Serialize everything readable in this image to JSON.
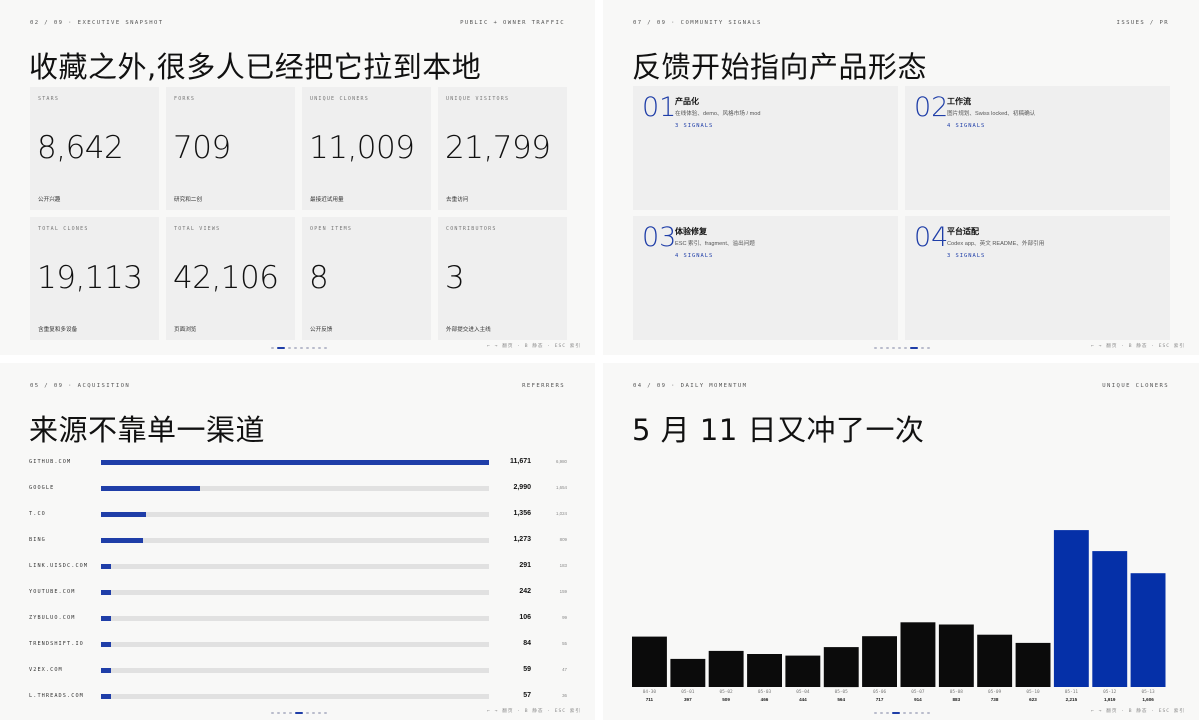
{
  "slides": [
    {
      "kicker": "02 / 09 · EXECUTIVE SNAPSHOT",
      "tag": "PUBLIC + OWNER TRAFFIC",
      "headline": "收藏之外,很多人已经把它拉到本地",
      "metrics": [
        {
          "label": "STARS",
          "value": "8,642",
          "note": "公开兴趣"
        },
        {
          "label": "FORKS",
          "value": "709",
          "note": "研究和二创"
        },
        {
          "label": "UNIQUE CLONERS",
          "value": "11,009",
          "note": "最接近试用量"
        },
        {
          "label": "UNIQUE VISITORS",
          "value": "21,799",
          "note": "去重访问"
        },
        {
          "label": "TOTAL CLONES",
          "value": "19,113",
          "note": "含重复和多设备"
        },
        {
          "label": "TOTAL VIEWS",
          "value": "42,106",
          "note": "页面浏览"
        },
        {
          "label": "OPEN ITEMS",
          "value": "8",
          "note": "公开反馈"
        },
        {
          "label": "CONTRIBUTORS",
          "value": "3",
          "note": "外部提交进入主线"
        }
      ],
      "nav_hint": "← → 翻页 · B 静态 · ESC 索引",
      "page_active": 1,
      "page_count": 9
    },
    {
      "kicker": "07 / 09 · COMMUNITY SIGNALS",
      "tag": "ISSUES / PR",
      "headline": "反馈开始指向产品形态",
      "signals": [
        {
          "num": "01",
          "title": "产品化",
          "desc": "在线体验、demo、风格市场 / mod",
          "count": "3 SIGNALS"
        },
        {
          "num": "02",
          "title": "工作流",
          "desc": "图片规划、Swiss locked、初稿确认",
          "count": "4 SIGNALS"
        },
        {
          "num": "03",
          "title": "体验修复",
          "desc": "ESC 索引、fragment、溢出问题",
          "count": "4 SIGNALS"
        },
        {
          "num": "04",
          "title": "平台适配",
          "desc": "Codex app、英文 README、外部引用",
          "count": "3 SIGNALS"
        }
      ],
      "nav_hint": "← → 翻页 · B 静态 · ESC 索引",
      "page_active": 6,
      "page_count": 9
    },
    {
      "kicker": "05 / 09 · ACQUISITION",
      "tag": "REFERRERS",
      "headline": "来源不靠单一渠道",
      "referrers": [
        {
          "name": "GITHUB.COM",
          "views": 11671,
          "views_label": "11,671",
          "uniques": "6,980"
        },
        {
          "name": "GOOGLE",
          "views": 2990,
          "views_label": "2,990",
          "uniques": "1,654"
        },
        {
          "name": "T.CO",
          "views": 1356,
          "views_label": "1,356",
          "uniques": "1,024"
        },
        {
          "name": "BING",
          "views": 1273,
          "views_label": "1,273",
          "uniques": "809"
        },
        {
          "name": "LINK.UISDC.COM",
          "views": 291,
          "views_label": "291",
          "uniques": "183"
        },
        {
          "name": "YOUTUBE.COM",
          "views": 242,
          "views_label": "242",
          "uniques": "159"
        },
        {
          "name": "ZYBULUO.COM",
          "views": 106,
          "views_label": "106",
          "uniques": "99"
        },
        {
          "name": "TRENDSHIFT.IO",
          "views": 84,
          "views_label": "84",
          "uniques": "55"
        },
        {
          "name": "V2EX.COM",
          "views": 59,
          "views_label": "59",
          "uniques": "47"
        },
        {
          "name": "L.THREADS.COM",
          "views": 57,
          "views_label": "57",
          "uniques": "36"
        }
      ],
      "nav_hint": "← → 翻页 · B 静态 · ESC 索引",
      "page_active": 4,
      "page_count": 9
    },
    {
      "kicker": "04 / 09 · DAILY MOMENTUM",
      "tag": "UNIQUE CLONERS",
      "headline": "5 月 11 日又冲了一次",
      "nav_hint": "← → 翻页 · B 静态 · ESC 索引",
      "page_active": 3,
      "page_count": 9
    }
  ],
  "chart_data": {
    "type": "bar",
    "categories": [
      "04-30",
      "05-01",
      "05-02",
      "05-03",
      "05-04",
      "05-05",
      "05-06",
      "05-07",
      "05-08",
      "05-09",
      "05-10",
      "05-11",
      "05-12",
      "05-13"
    ],
    "values": [
      711,
      397,
      509,
      466,
      444,
      564,
      717,
      914,
      883,
      738,
      623,
      2215,
      1919,
      1606
    ],
    "value_labels": [
      "711",
      "397",
      "509",
      "466",
      "444",
      "564",
      "717",
      "914",
      "883",
      "738",
      "623",
      "2,215",
      "1,919",
      "1,606"
    ],
    "highlight_from_index": 11,
    "colors": {
      "default": "#0b0b0b",
      "highlight": "#0530a8"
    },
    "title": "",
    "xlabel": "",
    "ylabel": "",
    "ylim": [
      0,
      2400
    ]
  },
  "colors": {
    "accent": "#1f3ea8",
    "card": "#efefef",
    "slide": "#f8f8f7",
    "bar_track": "#e1e1e1"
  }
}
